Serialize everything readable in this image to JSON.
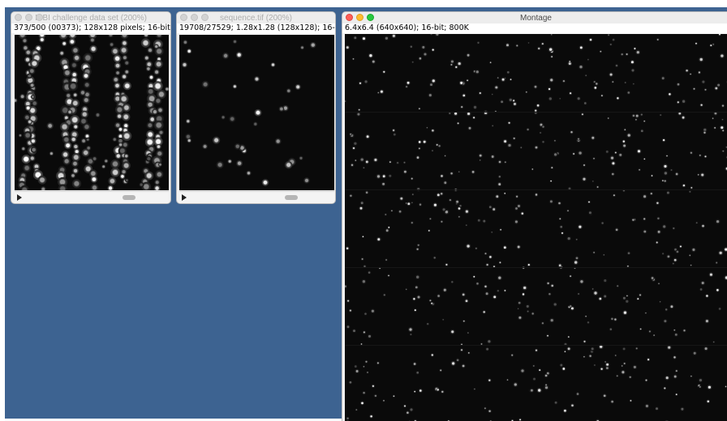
{
  "windows": {
    "isbi": {
      "title": "ISBI challenge data set (200%)",
      "info": "373/500 (00373); 128x128 pixels; 16-bit"
    },
    "sequence": {
      "title": "sequence.tif (200%)",
      "info": "19708/27529; 1.28x1.28  (128x128); 16-"
    },
    "montage": {
      "title": "Montage",
      "info": "6.4x6.4  (640x640); 16-bit; 800K"
    }
  },
  "icons": {
    "play": "play-icon",
    "close": "close-icon",
    "minimize": "minimize-icon",
    "zoom": "zoom-icon"
  },
  "colors": {
    "desktop": "#3d6391",
    "image_bg": "#0a0a0a",
    "close": "#ff5f57",
    "minimize": "#febc2e",
    "zoom": "#28c840"
  }
}
